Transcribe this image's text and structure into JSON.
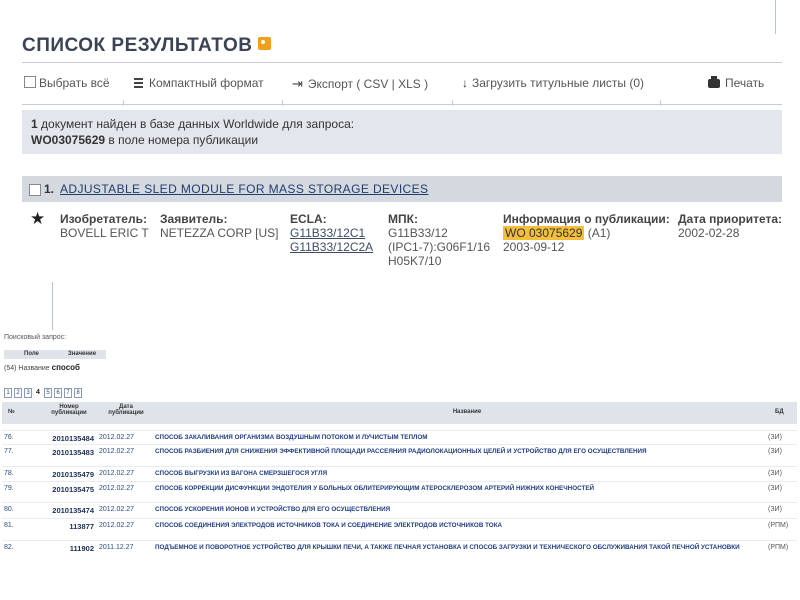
{
  "top": {
    "title": "СПИСОК РЕЗУЛЬТАТОВ",
    "toolbar": {
      "select_all": "Выбрать всё",
      "compact": "Компактный формат",
      "export": "Экспорт  ( CSV | XLS )",
      "download": "Загрузить титульные листы (0)",
      "print": "Печать"
    },
    "info": {
      "count": "1",
      "line1_rest": " документ найден в базе данных Worldwide для запроса:",
      "query": "WO03075629",
      "line2_rest": " в поле номера публикации"
    },
    "result": {
      "number": "1.",
      "title": "ADJUSTABLE SLED MODULE FOR MASS STORAGE DEVICES",
      "inventor_label": "Изобретатель:",
      "inventor": "BOVELL ERIC T",
      "applicant_label": "Заявитель:",
      "applicant": "NETEZZA CORP [US]",
      "ecla_label": "ECLA:",
      "ecla": [
        "G11B33/12C1",
        "G11B33/12C2A"
      ],
      "ipc_label": "МПК:",
      "ipc": [
        "G11B33/12",
        "(IPC1-7):G06F1/16",
        "H05K7/10"
      ],
      "pubinfo_label": "Информация о публикации:",
      "pub_number": "WO 03075629",
      "pub_kind": " (A1)",
      "pub_date": "2003-09-12",
      "priority_label": "Дата приоритета:",
      "priority_date": "2002-02-28"
    }
  },
  "bottom": {
    "query_label": "Поисковый запрос:",
    "qtable": {
      "h_field": "Поле",
      "h_value": "Значение",
      "row_field": "(54) Название",
      "row_value": "способ"
    },
    "pages": [
      "1",
      "2",
      "3",
      "4",
      "5",
      "6",
      "7",
      "8"
    ],
    "current_page": "4",
    "headers": {
      "no": "№",
      "pubnum_1": "Номер",
      "pubnum_2": "публикации",
      "date_1": "Дата",
      "date_2": "публикации",
      "name": "Название",
      "db": "БД"
    },
    "rows": [
      {
        "no": "76.",
        "num": "2010135484",
        "date": "2012.02.27",
        "name": "СПОСОБ ЗАКАЛИВАНИЯ ОРГАНИЗМА ВОЗДУШНЫМ ПОТОКОМ И ЛУЧИСТЫМ ТЕПЛОМ",
        "db": "(ЗИ)"
      },
      {
        "no": "77.",
        "num": "2010135483",
        "date": "2012.02.27",
        "name": "СПОСОБ РАЗБИЕНИЯ ДЛЯ СНИЖЕНИЯ ЭФФЕКТИВНОЙ ПЛОЩАДИ РАССЕЯНИЯ РАДИОЛОКАЦИОННЫХ ЦЕЛЕЙ И УСТРОЙСТВО ДЛЯ ЕГО ОСУЩЕСТВЛЕНИЯ",
        "db": "(ЗИ)"
      },
      {
        "no": "78.",
        "num": "2010135479",
        "date": "2012.02.27",
        "name": "СПОСОБ ВЫГРУЗКИ ИЗ ВАГОНА СМЕРЗШЕГОСЯ УГЛЯ",
        "db": "(ЗИ)"
      },
      {
        "no": "79.",
        "num": "2010135475",
        "date": "2012.02.27",
        "name": "СПОСОБ КОРРЕКЦИИ ДИСФУНКЦИИ ЭНДОТЕЛИЯ У БОЛЬНЫХ ОБЛИТЕРИРУЮЩИМ АТЕРОСКЛЕРОЗОМ АРТЕРИЙ НИЖНИХ КОНЕЧНОСТЕЙ",
        "db": "(ЗИ)"
      },
      {
        "no": "80.",
        "num": "2010135474",
        "date": "2012.02.27",
        "name": "СПОСОБ УСКОРЕНИЯ ИОНОВ И УСТРОЙСТВО ДЛЯ ЕГО ОСУЩЕСТВЛЕНИЯ",
        "db": "(ЗИ)"
      },
      {
        "no": "81.",
        "num": "113877",
        "date": "2012.02.27",
        "name": "СПОСОБ СОЕДИНЕНИЯ ЭЛЕКТРОДОВ ИСТОЧНИКОВ ТОКА И СОЕДИНЕНИЕ ЭЛЕКТРОДОВ ИСТОЧНИКОВ ТОКА",
        "db": "(РПМ)"
      },
      {
        "no": "82.",
        "num": "111902",
        "date": "2011.12.27",
        "name": "ПОДЪЕМНОЕ И ПОВОРОТНОЕ УСТРОЙСТВО ДЛЯ КРЫШКИ ПЕЧИ, А ТАКЖЕ ПЕЧНАЯ УСТАНОВКА И СПОСОБ ЗАГРУЗКИ И ТЕХНИЧЕСКОГО ОБСЛУЖИВАНИЯ ТАКОЙ ПЕЧНОЙ УСТАНОВКИ",
        "db": "(РПМ)"
      }
    ]
  }
}
